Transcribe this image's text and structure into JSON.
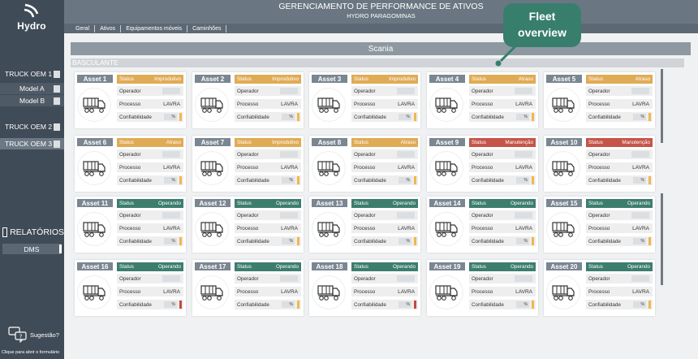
{
  "app": {
    "title": "GERENCIAMENTO DE PERFORMANCE DE ATIVOS",
    "subtitle": "HYDRO PARAGOMINAS",
    "logo_text": "Hydro"
  },
  "tabs": [
    {
      "label": "Geral"
    },
    {
      "label": "Ativos"
    },
    {
      "label": "Equipamentos móveis"
    },
    {
      "label": "Caminhões"
    }
  ],
  "sidebar": {
    "items": [
      {
        "label": "TRUCK OEM 1"
      },
      {
        "label": "Model A"
      },
      {
        "label": "Model B"
      },
      {
        "label": "TRUCK OEM 2"
      },
      {
        "label": "TRUCK OEM 3"
      }
    ],
    "reports_label": "RELATÓRIOS",
    "dms_label": "DMS",
    "suggest_label": "Sugestão?",
    "suggest_hint": "Clique para abrir o formulário"
  },
  "main": {
    "banner": "Scania",
    "group": "BASCULANTE"
  },
  "labels": {
    "status": "Status",
    "operador": "Operador",
    "processo": "Processo",
    "confiabilidade": "Confiabilidade",
    "percent": "%"
  },
  "colors": {
    "improdutivo": "#e0ab55",
    "atraso": "#e0ab55",
    "manutencao": "#c65448",
    "operando": "#3c7d6e",
    "bar_yellow": "#f0b84a",
    "bar_red": "#c9473b",
    "accent_callout": "#377e6d"
  },
  "assets": [
    {
      "name": "Asset 1",
      "status": "Improdutivo",
      "status_color": "#e0ab55",
      "processo": "LAVRA",
      "bar": "#f0b84a"
    },
    {
      "name": "Asset 2",
      "status": "Improdutivo",
      "status_color": "#e0ab55",
      "processo": "LAVRA",
      "bar": "#f0b84a"
    },
    {
      "name": "Asset 3",
      "status": "Improdutivo",
      "status_color": "#e0ab55",
      "processo": "LAVRA",
      "bar": "#f0b84a"
    },
    {
      "name": "Asset 4",
      "status": "Atraso",
      "status_color": "#e0ab55",
      "processo": "LAVRA",
      "bar": "#f0b84a"
    },
    {
      "name": "Asset 5",
      "status": "Atraso",
      "status_color": "#e0ab55",
      "processo": "LAVRA",
      "bar": "#f0b84a"
    },
    {
      "name": "Asset 6",
      "status": "Atraso",
      "status_color": "#e0ab55",
      "processo": "LAVRA",
      "bar": "#f0b84a"
    },
    {
      "name": "Asset 7",
      "status": "Improdutivo",
      "status_color": "#e0ab55",
      "processo": "LAVRA",
      "bar": "#f0b84a"
    },
    {
      "name": "Asset 8",
      "status": "Atraso",
      "status_color": "#e0ab55",
      "processo": "LAVRA",
      "bar": "#f0b84a"
    },
    {
      "name": "Asset 9",
      "status": "Manutenção",
      "status_color": "#c65448",
      "processo": "LAVRA",
      "bar": "#f0b84a"
    },
    {
      "name": "Asset 10",
      "status": "Manutenção",
      "status_color": "#c65448",
      "processo": "LAVRA",
      "bar": "#f0b84a"
    },
    {
      "name": "Asset 11",
      "status": "Operando",
      "status_color": "#3c7d6e",
      "processo": "LAVRA",
      "bar": "#f0b84a"
    },
    {
      "name": "Asset 12",
      "status": "Operando",
      "status_color": "#3c7d6e",
      "processo": "LAVRA",
      "bar": "#f0b84a"
    },
    {
      "name": "Asset 13",
      "status": "Operando",
      "status_color": "#3c7d6e",
      "processo": "LAVRA",
      "bar": "#f0b84a"
    },
    {
      "name": "Asset 14",
      "status": "Operando",
      "status_color": "#3c7d6e",
      "processo": "LAVRA",
      "bar": "#f0b84a"
    },
    {
      "name": "Asset 15",
      "status": "Operando",
      "status_color": "#3c7d6e",
      "processo": "LAVRA",
      "bar": "#f0b84a"
    },
    {
      "name": "Asset 16",
      "status": "Operando",
      "status_color": "#3c7d6e",
      "processo": "LAVRA",
      "bar": "#c9473b"
    },
    {
      "name": "Asset 17",
      "status": "Operando",
      "status_color": "#3c7d6e",
      "processo": "LAVRA",
      "bar": "#f0b84a"
    },
    {
      "name": "Asset 18",
      "status": "Operando",
      "status_color": "#3c7d6e",
      "processo": "LAVRA",
      "bar": "#c9473b"
    },
    {
      "name": "Asset 19",
      "status": "Operando",
      "status_color": "#3c7d6e",
      "processo": "LAVRA",
      "bar": "#f0b84a"
    },
    {
      "name": "Asset 20",
      "status": "Operando",
      "status_color": "#3c7d6e",
      "processo": "LAVRA",
      "bar": "#f0b84a"
    }
  ],
  "callout": {
    "line1": "Fleet",
    "line2": "overview"
  }
}
